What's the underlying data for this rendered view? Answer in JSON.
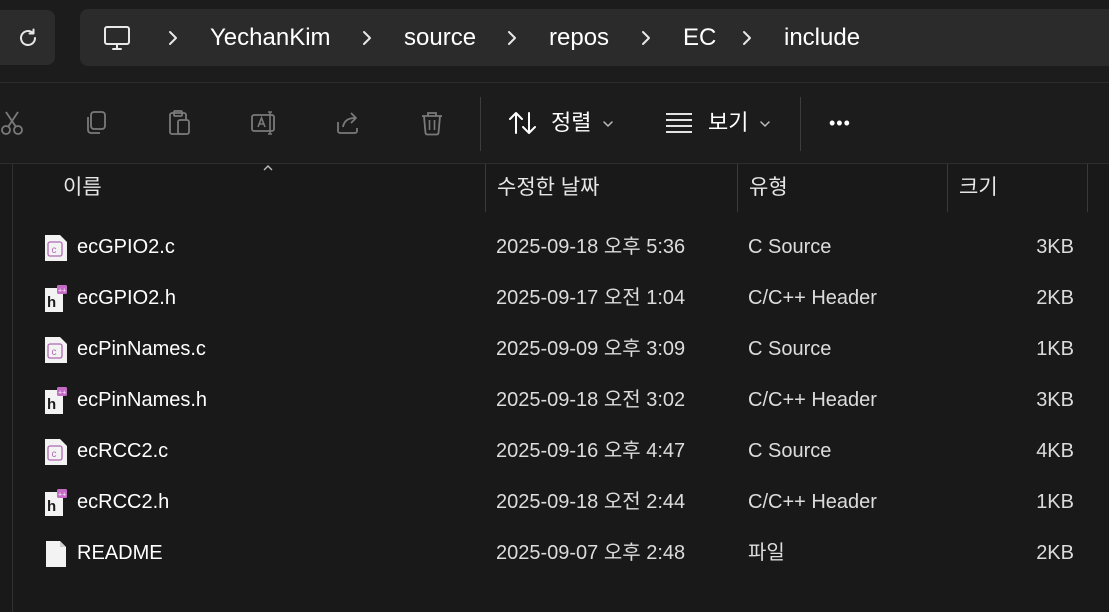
{
  "address": {
    "refresh_icon": "refresh-icon",
    "pc_icon": "this-pc-icon",
    "crumbs": [
      "YechanKim",
      "source",
      "repos",
      "EC",
      "include"
    ]
  },
  "toolbar": {
    "icons": [
      "cut-icon",
      "copy-icon",
      "paste-icon",
      "rename-icon",
      "share-icon",
      "delete-icon"
    ],
    "sort_label": "정렬",
    "view_label": "보기",
    "more_label": "•••"
  },
  "columns": {
    "name": "이름",
    "date": "수정한 날짜",
    "type": "유형",
    "size": "크기"
  },
  "files": [
    {
      "name": "ecGPIO2.c",
      "date": "2025-09-18 오후 5:36",
      "type": "C Source",
      "size": "3KB",
      "icon": "c-source-file-icon"
    },
    {
      "name": "ecGPIO2.h",
      "date": "2025-09-17 오전 1:04",
      "type": "C/C++ Header",
      "size": "2KB",
      "icon": "header-file-icon"
    },
    {
      "name": "ecPinNames.c",
      "date": "2025-09-09 오후 3:09",
      "type": "C Source",
      "size": "1KB",
      "icon": "c-source-file-icon"
    },
    {
      "name": "ecPinNames.h",
      "date": "2025-09-18 오전 3:02",
      "type": "C/C++ Header",
      "size": "3KB",
      "icon": "header-file-icon"
    },
    {
      "name": "ecRCC2.c",
      "date": "2025-09-16 오후 4:47",
      "type": "C Source",
      "size": "4KB",
      "icon": "c-source-file-icon"
    },
    {
      "name": "ecRCC2.h",
      "date": "2025-09-18 오전 2:44",
      "type": "C/C++ Header",
      "size": "1KB",
      "icon": "header-file-icon"
    },
    {
      "name": "README",
      "date": "2025-09-07 오후 2:48",
      "type": "파일",
      "size": "2KB",
      "icon": "generic-file-icon"
    }
  ],
  "colors": {
    "background": "#1c1c1c",
    "list_background": "#191919",
    "address_box": "#2b2b2b",
    "c_badge": "#b06ab3",
    "h_badge": "#c46bc6"
  }
}
